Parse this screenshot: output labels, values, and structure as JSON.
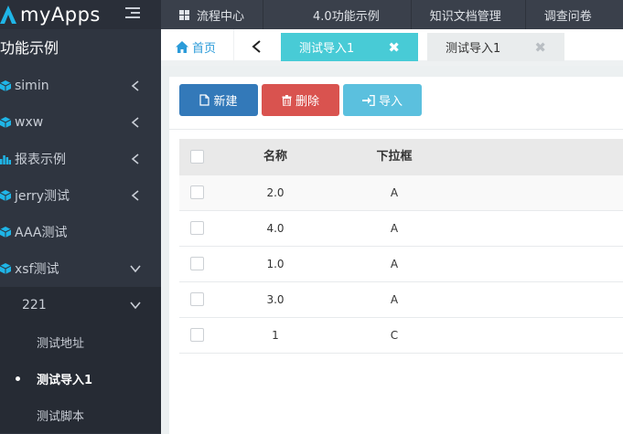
{
  "app": {
    "logo_text": "myApps"
  },
  "sidebar": {
    "section_title": "功能示例",
    "items": [
      {
        "label": "simin",
        "icon": "cube-icon",
        "expanded": false
      },
      {
        "label": "wxw",
        "icon": "cube-icon",
        "expanded": false
      },
      {
        "label": "报表示例",
        "icon": "bar-chart-icon",
        "expanded": false
      },
      {
        "label": "jerry测试",
        "icon": "cube-icon",
        "expanded": false
      },
      {
        "label": "AAA测试",
        "icon": "cube-icon"
      },
      {
        "label": "xsf测试",
        "icon": "cube-icon",
        "expanded": true
      }
    ],
    "sub_group": {
      "label": "221",
      "expanded": true
    },
    "sub_items": [
      {
        "label": "测试地址"
      },
      {
        "label": "测试导入1",
        "active": true
      },
      {
        "label": "测试脚本"
      }
    ]
  },
  "topnav": [
    {
      "label": "流程中心",
      "icon": "grid-icon"
    },
    {
      "label": "4.0功能示例"
    },
    {
      "label": "知识文档管理"
    },
    {
      "label": "调查问卷"
    }
  ],
  "tabs": {
    "home_label": "首页",
    "open": [
      {
        "label": "测试导入1",
        "active": true,
        "close": "✖"
      },
      {
        "label": "测试导入1",
        "active": false,
        "close": "✖"
      }
    ]
  },
  "toolbar": {
    "new_label": "新建",
    "delete_label": "删除",
    "import_label": "导入"
  },
  "table": {
    "columns": [
      "名称",
      "下拉框"
    ],
    "rows": [
      {
        "name": "2.0",
        "select": "A"
      },
      {
        "name": "4.0",
        "select": "A"
      },
      {
        "name": "1.0",
        "select": "A"
      },
      {
        "name": "3.0",
        "select": "A"
      },
      {
        "name": "1",
        "select": "C"
      }
    ]
  },
  "colors": {
    "sidebar_bg": "#2f3540",
    "topnav_bg": "#3a404b",
    "active_tab": "#48cbd6",
    "btn_new": "#3379b9",
    "btn_delete": "#d9534f",
    "btn_import": "#5bc0de",
    "icon_accent": "#1fb5e7"
  }
}
